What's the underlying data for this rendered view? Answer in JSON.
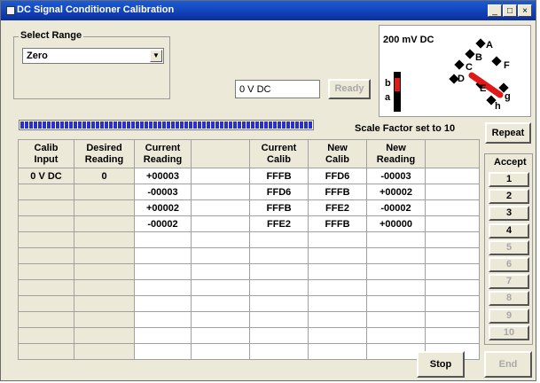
{
  "window": {
    "title": "DC Signal Conditioner Calibration",
    "controls": [
      "_",
      "□",
      "×"
    ]
  },
  "range": {
    "label": "Select Range",
    "selected": "Zero"
  },
  "input_value": "0 V DC",
  "ready_label": "Ready",
  "panel": {
    "range_text": "200 mV DC",
    "points": [
      "A",
      "B",
      "C",
      "D",
      "E",
      "F",
      "g",
      "h"
    ],
    "left_labels": [
      "b",
      "a"
    ]
  },
  "progress": {
    "fraction": 1.0
  },
  "scale_text": "Scale Factor set to 10",
  "repeat_label": "Repeat",
  "table": {
    "headers": [
      [
        "Calib",
        "Input"
      ],
      [
        "Desired",
        "Reading"
      ],
      [
        "Current",
        "Reading"
      ],
      [
        "",
        ""
      ],
      [
        "Current",
        "Calib"
      ],
      [
        "New",
        "Calib"
      ],
      [
        "New",
        "Reading"
      ],
      [
        "",
        ""
      ]
    ],
    "rows": [
      [
        "0 V DC",
        "0",
        "+00003",
        "",
        "FFFB",
        "FFD6",
        "-00003",
        ""
      ],
      [
        "",
        "",
        "-00003",
        "",
        "FFD6",
        "FFFB",
        "+00002",
        ""
      ],
      [
        "",
        "",
        "+00002",
        "",
        "FFFB",
        "FFE2",
        "-00002",
        ""
      ],
      [
        "",
        "",
        "-00002",
        "",
        "FFE2",
        "FFFB",
        "+00000",
        ""
      ],
      [
        "",
        "",
        "",
        "",
        "",
        "",
        "",
        ""
      ],
      [
        "",
        "",
        "",
        "",
        "",
        "",
        "",
        ""
      ],
      [
        "",
        "",
        "",
        "",
        "",
        "",
        "",
        ""
      ],
      [
        "",
        "",
        "",
        "",
        "",
        "",
        "",
        ""
      ],
      [
        "",
        "",
        "",
        "",
        "",
        "",
        "",
        ""
      ],
      [
        "",
        "",
        "",
        "",
        "",
        "",
        "",
        ""
      ],
      [
        "",
        "",
        "",
        "",
        "",
        "",
        "",
        ""
      ],
      [
        "",
        "",
        "",
        "",
        "",
        "",
        "",
        ""
      ]
    ]
  },
  "accept": {
    "label": "Accept",
    "buttons": [
      "1",
      "2",
      "3",
      "4",
      "5",
      "6",
      "7",
      "8",
      "9",
      "10"
    ],
    "enabled_count": 4
  },
  "stop_label": "Stop",
  "end_label": "End",
  "colors": {
    "title_bar": "#0a2f9e",
    "progress": "#2a2fd0",
    "marker": "#e01818",
    "face": "#ece9d8"
  }
}
